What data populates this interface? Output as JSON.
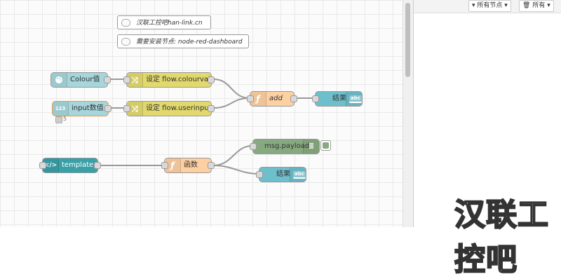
{
  "canvas": {
    "comments": [
      {
        "text": "汉联工控吧han-link.cn"
      },
      {
        "text": "需要安装节点: node-red-dashboard"
      }
    ],
    "nodes": {
      "colour": {
        "label": "Colour值",
        "color": "#a6d6db"
      },
      "set_colour": {
        "label": "设定 flow.colourval",
        "color": "#e2d96e"
      },
      "input": {
        "label": "input数值",
        "color": "#a6d6db",
        "icon_text": "123"
      },
      "set_input": {
        "label": "设定 flow.userinput",
        "color": "#e2d96e"
      },
      "add": {
        "label": "add",
        "color": "#fdd0a2"
      },
      "result1": {
        "label": "结果",
        "color": "#6ebfcc",
        "badge": "abc"
      },
      "template": {
        "label": "template",
        "color": "#3aa0a8"
      },
      "func": {
        "label": "函数",
        "color": "#fdd0a2"
      },
      "payload": {
        "label": "msg.payload",
        "color": "#87a980"
      },
      "result2": {
        "label": "结果",
        "color": "#6ebfcc",
        "badge": "abc"
      }
    },
    "status": {
      "value": "5"
    }
  },
  "sidebar": {
    "filter_nodes": "所有节点",
    "filter_all": "所有"
  },
  "watermark": "汉联工控吧"
}
